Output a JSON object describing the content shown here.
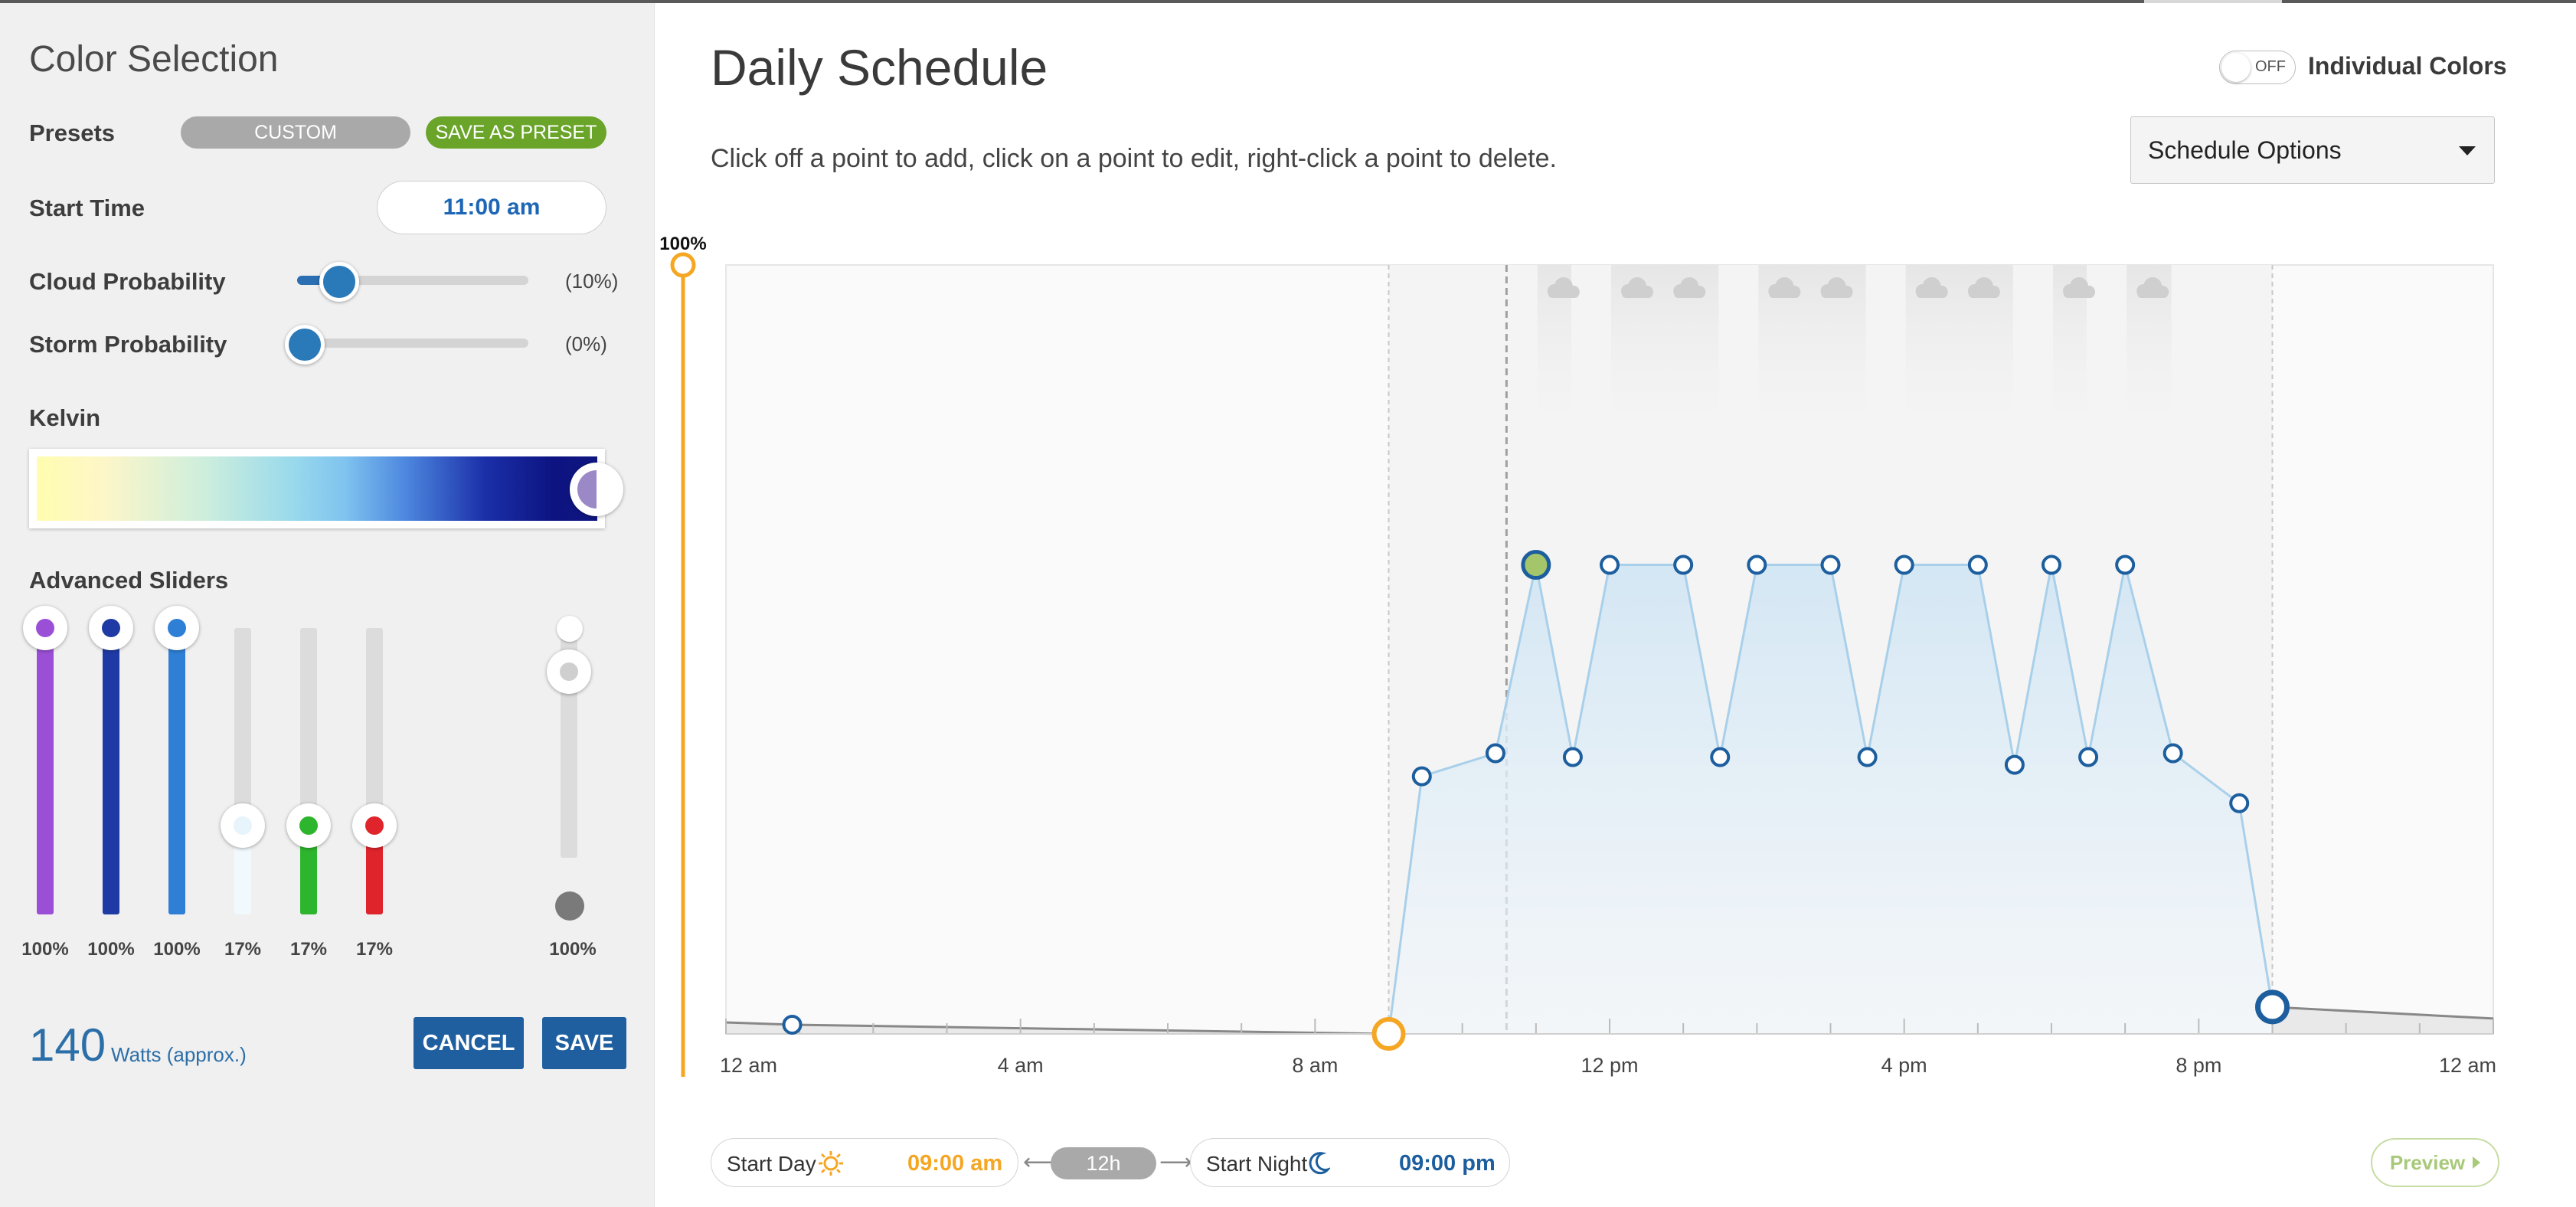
{
  "left": {
    "title": "Color Selection",
    "presets": {
      "label": "Presets",
      "custom": "CUSTOM",
      "save_as": "SAVE AS PRESET"
    },
    "start_time": {
      "label": "Start Time",
      "value": "11:00 am"
    },
    "cloud": {
      "label": "Cloud Probability",
      "value_text": "(10%)",
      "value": 10
    },
    "storm": {
      "label": "Storm Probability",
      "value_text": "(0%)",
      "value": 0
    },
    "kelvin": {
      "label": "Kelvin",
      "position": 1.0
    },
    "advanced": {
      "label": "Advanced Sliders",
      "channels": [
        {
          "pct": "100%",
          "value": 100,
          "color": "#9b4fd6"
        },
        {
          "pct": "100%",
          "value": 100,
          "color": "#1f3aa5"
        },
        {
          "pct": "100%",
          "value": 100,
          "color": "#2f7fd6"
        },
        {
          "pct": "17%",
          "value": 17,
          "color": "#e8f4fb"
        },
        {
          "pct": "17%",
          "value": 17,
          "color": "#2db52d"
        },
        {
          "pct": "17%",
          "value": 17,
          "color": "#e0242c"
        }
      ],
      "master": {
        "pct": "100%",
        "value": 100
      }
    },
    "watts": {
      "value": "140",
      "label": "Watts (approx.)"
    },
    "cancel": "CANCEL",
    "save": "SAVE"
  },
  "schedule": {
    "title": "Daily Schedule",
    "instructions": "Click off a point to add, click on a point to edit, right-click a point to delete.",
    "toggle_text": "OFF",
    "individual_colors": "Individual Colors",
    "options_label": "Schedule Options",
    "start_day": {
      "label": "Start Day",
      "time": "09:00 am"
    },
    "duration": "12h",
    "start_night": {
      "label": "Start Night",
      "time": "09:00 pm"
    },
    "preview": "Preview",
    "day_color": "#f5a623",
    "night_color": "#1c5e9e"
  },
  "chart_data": {
    "type": "line",
    "x_unit": "hour of day",
    "xlim": [
      0,
      24
    ],
    "ylim": [
      0,
      100
    ],
    "ymax_label": "100%",
    "tick_labels": [
      "12 am",
      "4 am",
      "8 am",
      "12 pm",
      "4 pm",
      "8 pm",
      "12 am"
    ],
    "tick_hours": [
      0,
      4,
      8,
      12,
      16,
      20,
      24
    ],
    "day_start": 9,
    "night_start": 21,
    "current_time": 10.6,
    "night_points": [
      {
        "x": 0,
        "y": 1.5
      },
      {
        "x": 0.9,
        "y": 1.2
      },
      {
        "x": 9,
        "y": 0
      },
      {
        "x": 21,
        "y": 3.5
      },
      {
        "x": 24,
        "y": 2
      }
    ],
    "day_points": [
      {
        "x": 9,
        "y": 0
      },
      {
        "x": 9.45,
        "y": 33.5
      },
      {
        "x": 10.45,
        "y": 36.5
      },
      {
        "x": 11,
        "y": 61,
        "selected": true
      },
      {
        "x": 11.5,
        "y": 36
      },
      {
        "x": 12,
        "y": 61
      },
      {
        "x": 13,
        "y": 61
      },
      {
        "x": 13.5,
        "y": 36
      },
      {
        "x": 14,
        "y": 61
      },
      {
        "x": 15,
        "y": 61
      },
      {
        "x": 15.5,
        "y": 36
      },
      {
        "x": 16,
        "y": 61
      },
      {
        "x": 17,
        "y": 61
      },
      {
        "x": 17.5,
        "y": 35
      },
      {
        "x": 18,
        "y": 61
      },
      {
        "x": 18.5,
        "y": 36
      },
      {
        "x": 19,
        "y": 61
      },
      {
        "x": 19.65,
        "y": 36.5
      },
      {
        "x": 20.55,
        "y": 30
      },
      {
        "x": 21,
        "y": 3.5
      }
    ],
    "cloud_periods": [
      [
        11,
        11.5
      ],
      [
        12,
        13.5
      ],
      [
        14,
        15.5
      ],
      [
        16,
        17.5
      ],
      [
        18,
        18.5
      ],
      [
        19,
        19.65
      ]
    ]
  }
}
